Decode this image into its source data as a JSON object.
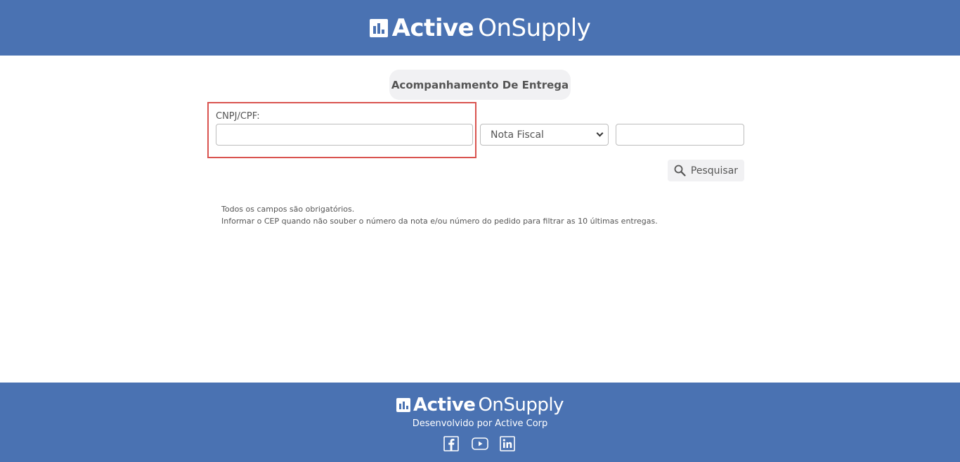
{
  "brand": {
    "name_bold": "Active",
    "name_light": "OnSupply"
  },
  "page": {
    "title": "Acompanhamento De Entrega"
  },
  "form": {
    "cnpj_label": "CNPJ/CPF:",
    "cnpj_value": "",
    "filter_type_selected": "Nota Fiscal",
    "filter_value": "",
    "search_label": "Pesquisar"
  },
  "info": {
    "line1": "Todos os campos são obrigatórios.",
    "line2": "Informar o CEP quando não souber o número da nota e/ou número do pedido para filtrar as 10 últimas entregas."
  },
  "footer": {
    "credit": "Desenvolvido por Active Corp",
    "social_icons": [
      "facebook-icon",
      "youtube-icon",
      "linkedin-icon"
    ]
  },
  "colors": {
    "brand_blue": "#4a72b2",
    "highlight_red": "#d9534f",
    "pill_gray": "#f1f1f3"
  }
}
